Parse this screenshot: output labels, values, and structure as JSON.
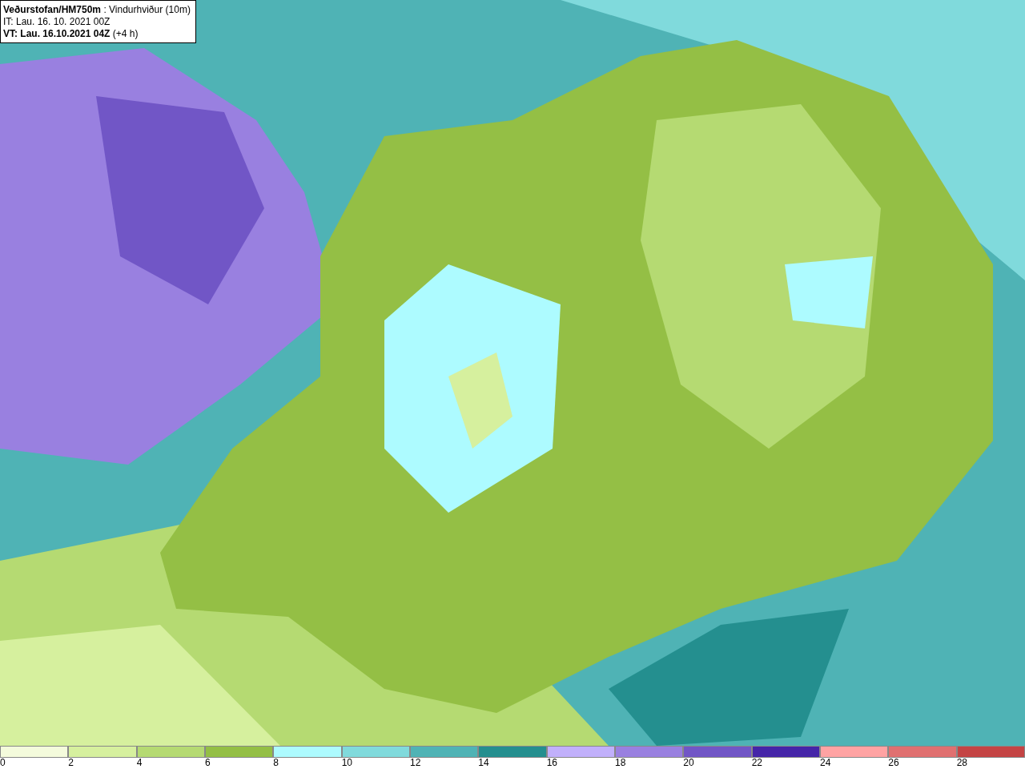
{
  "title_box": {
    "lines": [
      "**Veðurstofan/HM750m** : Vindurhviður (10m)",
      "IT: Lau. 16. 10. 2021 00Z",
      "**VT: Lau. 16.10.2021 04Z** (+4 h)"
    ]
  },
  "legend": {
    "bins": [
      {
        "label": "0",
        "color": "#f4fbdc"
      },
      {
        "label": "2",
        "color": "#d6f09e"
      },
      {
        "label": "4",
        "color": "#b5da72"
      },
      {
        "label": "6",
        "color": "#94bf45"
      },
      {
        "label": "8",
        "color": "#adfbff"
      },
      {
        "label": "10",
        "color": "#80dadc"
      },
      {
        "label": "12",
        "color": "#4fb3b5"
      },
      {
        "label": "14",
        "color": "#248f8f"
      },
      {
        "label": "16",
        "color": "#c1b0fb"
      },
      {
        "label": "18",
        "color": "#9980e0"
      },
      {
        "label": "20",
        "color": "#7156c6"
      },
      {
        "label": "22",
        "color": "#4525a8"
      },
      {
        "label": "24",
        "color": "#ffa3a3"
      },
      {
        "label": "26",
        "color": "#e07070"
      },
      {
        "label": "28",
        "color": "#c44444"
      }
    ]
  }
}
